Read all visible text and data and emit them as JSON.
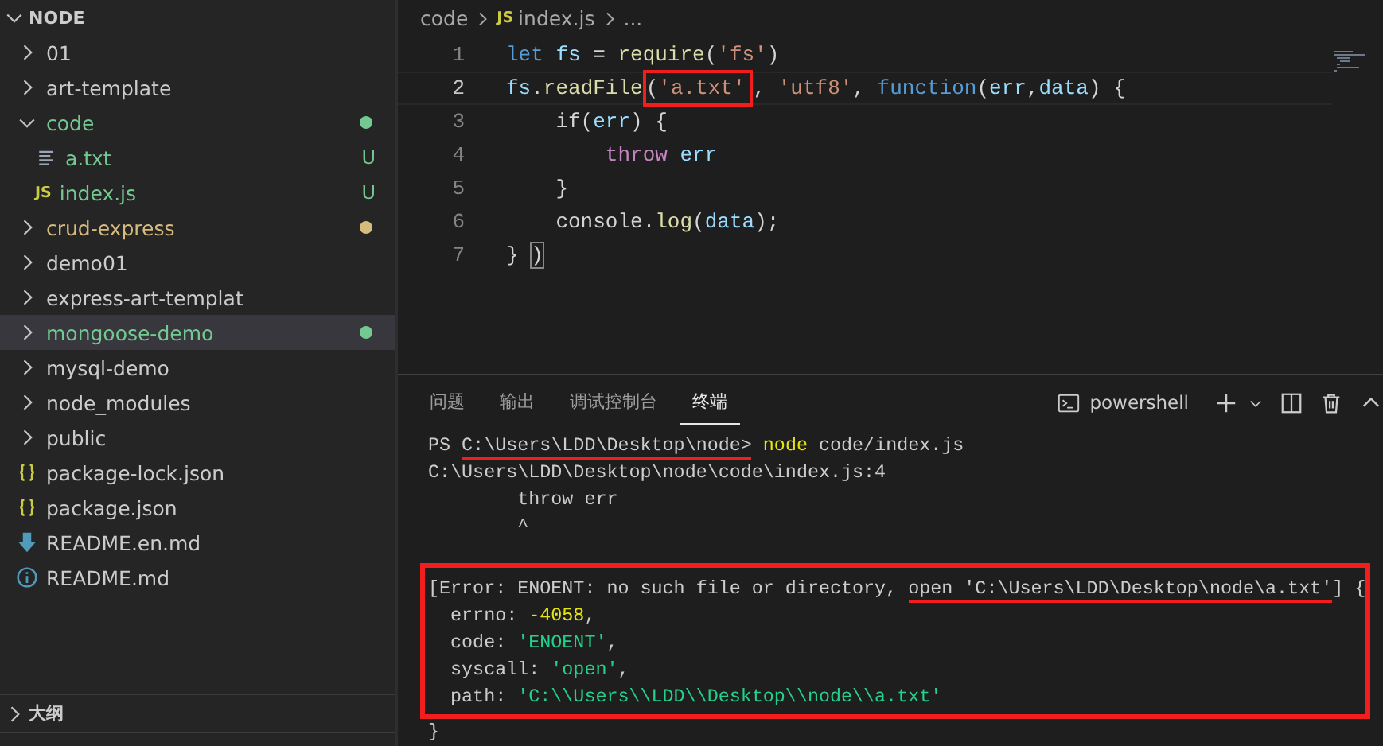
{
  "explorer": {
    "title": "NODE",
    "expanded": true,
    "items": [
      {
        "name": "01",
        "kind": "folder",
        "expanded": false,
        "selected": false
      },
      {
        "name": "art-template",
        "kind": "folder",
        "expanded": false,
        "selected": false
      },
      {
        "name": "code",
        "kind": "folder",
        "expanded": true,
        "selected": false,
        "color": "#73c991",
        "modified": true,
        "children": [
          {
            "name": "a.txt",
            "kind": "text",
            "selected": false,
            "color": "#73c991",
            "status": "U"
          },
          {
            "name": "index.js",
            "kind": "js",
            "badge": "JS",
            "selected": false,
            "color": "#73c991",
            "status": "U"
          }
        ]
      },
      {
        "name": "crud-express",
        "kind": "folder",
        "expanded": false,
        "selected": false,
        "color": "#d7ba7d",
        "modified": true
      },
      {
        "name": "demo01",
        "kind": "folder",
        "expanded": false,
        "selected": false
      },
      {
        "name": "express-art-templat",
        "kind": "folder",
        "expanded": false,
        "selected": false
      },
      {
        "name": "mongoose-demo",
        "kind": "folder",
        "expanded": false,
        "selected": true,
        "color": "#73c991",
        "modified": true
      },
      {
        "name": "mysql-demo",
        "kind": "folder",
        "expanded": false,
        "selected": false
      },
      {
        "name": "node_modules",
        "kind": "folder",
        "expanded": false,
        "selected": false
      },
      {
        "name": "public",
        "kind": "folder",
        "expanded": false,
        "selected": false
      },
      {
        "name": "package-lock.json",
        "kind": "json",
        "selected": false
      },
      {
        "name": "package.json",
        "kind": "json",
        "selected": false
      },
      {
        "name": "README.en.md",
        "kind": "download",
        "selected": false
      },
      {
        "name": "README.md",
        "kind": "info",
        "selected": false
      }
    ]
  },
  "outline": {
    "title": "大纲",
    "expanded": false
  },
  "breadcrumb": {
    "folder": "code",
    "file_badge": "JS",
    "file": "index.js",
    "more": "..."
  },
  "code": [
    {
      "number": "1",
      "current": false,
      "tokens": [
        {
          "text": "let",
          "kind": "keyword"
        },
        {
          "text": " fs",
          "kind": "var"
        },
        {
          "text": " = ",
          "kind": "plain"
        },
        {
          "text": "require",
          "kind": "func"
        },
        {
          "text": "(",
          "kind": "plain"
        },
        {
          "text": "'fs'",
          "kind": "str"
        },
        {
          "text": ")",
          "kind": "plain"
        }
      ]
    },
    {
      "number": "2",
      "current": true,
      "tokens": [
        {
          "text": "fs",
          "kind": "var"
        },
        {
          "text": ".",
          "kind": "plain"
        },
        {
          "text": "readFile",
          "kind": "func"
        },
        {
          "text": "(",
          "kind": "boxed"
        },
        {
          "text": "'a.txt'",
          "kind": "boxed-str"
        },
        {
          "text": ", ",
          "kind": "plain"
        },
        {
          "text": "'utf8'",
          "kind": "str"
        },
        {
          "text": ", ",
          "kind": "plain"
        },
        {
          "text": "function",
          "kind": "keyword"
        },
        {
          "text": "(",
          "kind": "plain"
        },
        {
          "text": "err",
          "kind": "var"
        },
        {
          "text": ",",
          "kind": "plain"
        },
        {
          "text": "data",
          "kind": "var"
        },
        {
          "text": ") {",
          "kind": "plain"
        }
      ]
    },
    {
      "number": "3",
      "current": false,
      "tokens": [
        {
          "text": "    if(",
          "kind": "plain"
        },
        {
          "text": "err",
          "kind": "var"
        },
        {
          "text": ") {",
          "kind": "plain"
        }
      ]
    },
    {
      "number": "4",
      "current": false,
      "tokens": [
        {
          "text": "        throw",
          "kind": "control"
        },
        {
          "text": " err",
          "kind": "var"
        }
      ]
    },
    {
      "number": "5",
      "current": false,
      "tokens": [
        {
          "text": "    }",
          "kind": "plain"
        }
      ]
    },
    {
      "number": "6",
      "current": false,
      "tokens": [
        {
          "text": "    console.",
          "kind": "plain"
        },
        {
          "text": "log",
          "kind": "func"
        },
        {
          "text": "(",
          "kind": "plain"
        },
        {
          "text": "data",
          "kind": "var"
        },
        {
          "text": ");",
          "kind": "plain"
        }
      ]
    },
    {
      "number": "7",
      "current": false,
      "tokens": [
        {
          "text": "} ",
          "kind": "plain"
        },
        {
          "text": ")",
          "kind": "bracket-match"
        }
      ]
    }
  ],
  "panel": {
    "tabs": [
      {
        "label": "问题",
        "selected": false
      },
      {
        "label": "输出",
        "selected": false
      },
      {
        "label": "调试控制台",
        "selected": false
      },
      {
        "label": "终端",
        "selected": true
      }
    ],
    "shell": "powershell",
    "lines": [
      [
        {
          "text": "PS ",
          "kind": "plain"
        },
        {
          "text": "C:\\Users\\LDD\\Desktop\\node>",
          "kind": "underlined"
        },
        {
          "text": " node",
          "kind": "cmd"
        },
        {
          "text": " code/index.js",
          "kind": "plain"
        }
      ],
      [
        {
          "text": "C:\\Users\\LDD\\Desktop\\node\\code\\index.js:4",
          "kind": "plain"
        }
      ],
      [
        {
          "text": "        throw err",
          "kind": "plain"
        }
      ],
      [
        {
          "text": "        ^",
          "kind": "plain"
        }
      ]
    ],
    "error_lines": [
      [
        {
          "text": "[Error: ENOENT: no such file or directory, ",
          "kind": "plain"
        },
        {
          "text": "open 'C:\\Users\\LDD\\Desktop\\node\\a.txt'",
          "kind": "underlined"
        },
        {
          "text": "] {",
          "kind": "plain"
        }
      ],
      [
        {
          "text": "  errno: ",
          "kind": "plain"
        },
        {
          "text": "-4058",
          "kind": "num"
        },
        {
          "text": ",",
          "kind": "plain"
        }
      ],
      [
        {
          "text": "  code: ",
          "kind": "plain"
        },
        {
          "text": "'ENOENT'",
          "kind": "str"
        },
        {
          "text": ",",
          "kind": "plain"
        }
      ],
      [
        {
          "text": "  syscall: ",
          "kind": "plain"
        },
        {
          "text": "'open'",
          "kind": "str"
        },
        {
          "text": ",",
          "kind": "plain"
        }
      ],
      [
        {
          "text": "  path: ",
          "kind": "plain"
        },
        {
          "text": "'C:\\\\Users\\\\LDD\\\\Desktop\\\\node\\\\a.txt'",
          "kind": "str"
        }
      ]
    ],
    "after_lines": [
      [
        {
          "text": "}",
          "kind": "plain"
        }
      ]
    ]
  }
}
